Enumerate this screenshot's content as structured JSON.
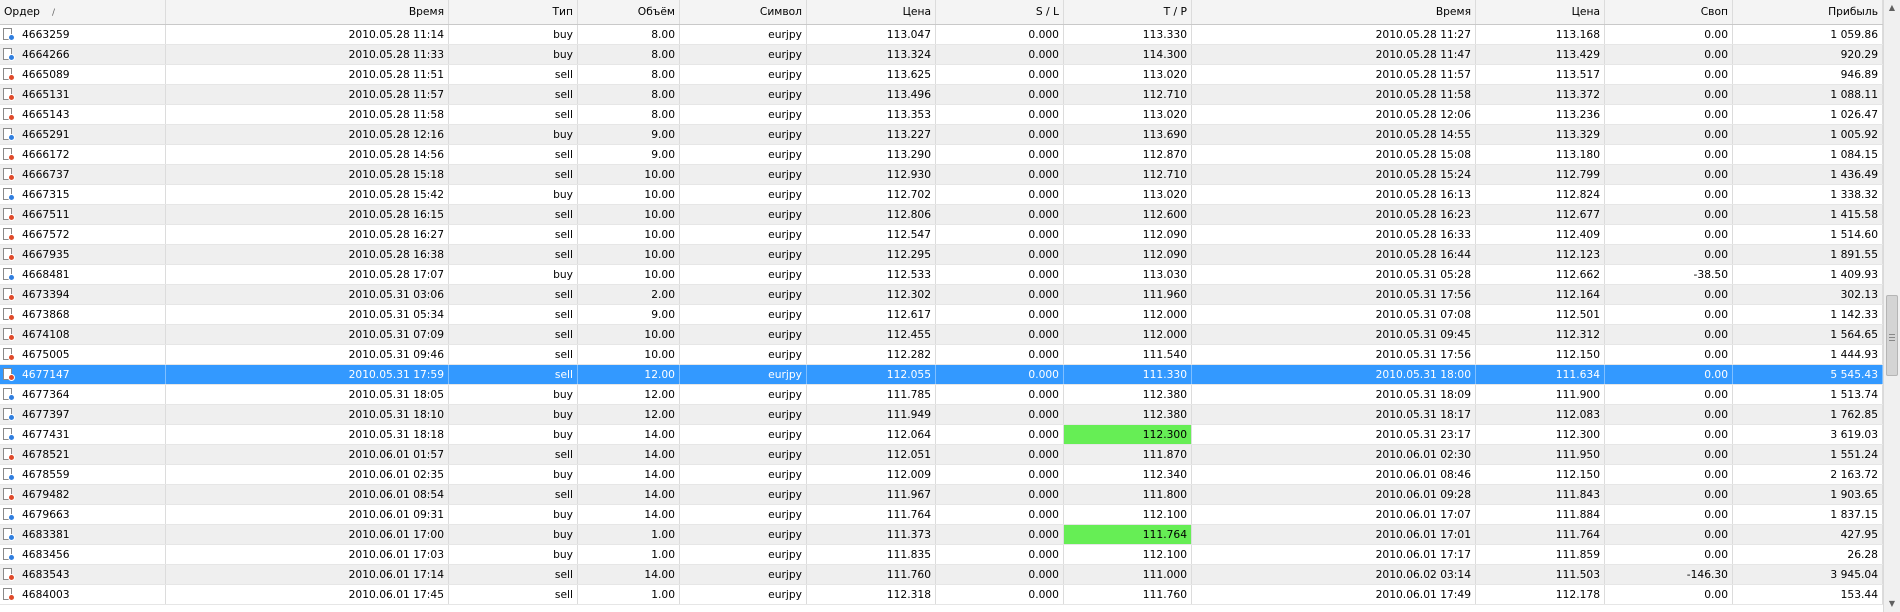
{
  "columns": [
    {
      "key": "order",
      "label": "Ордер",
      "sort_indicator": "/"
    },
    {
      "key": "open_time",
      "label": "Время"
    },
    {
      "key": "type",
      "label": "Тип"
    },
    {
      "key": "volume",
      "label": "Объём"
    },
    {
      "key": "symbol",
      "label": "Символ"
    },
    {
      "key": "open_price",
      "label": "Цена"
    },
    {
      "key": "sl",
      "label": "S / L"
    },
    {
      "key": "tp",
      "label": "T / P"
    },
    {
      "key": "close_time",
      "label": "Время"
    },
    {
      "key": "close_price",
      "label": "Цена"
    },
    {
      "key": "swap",
      "label": "Своп"
    },
    {
      "key": "profit",
      "label": "Прибыль"
    }
  ],
  "colors": {
    "selected_row": "#3399ff",
    "tp_hit": "#66ee55",
    "buy_icon": "#2f7fe0",
    "sell_icon": "#e04a2a"
  },
  "selected_order": "4677147",
  "rows": [
    {
      "order": "4663259",
      "open_time": "2010.05.28 11:14",
      "type": "buy",
      "volume": "8.00",
      "symbol": "eurjpy",
      "open_price": "113.047",
      "sl": "0.000",
      "tp": "113.330",
      "close_time": "2010.05.28 11:27",
      "close_price": "113.168",
      "swap": "0.00",
      "profit": "1 059.86"
    },
    {
      "order": "4664266",
      "open_time": "2010.05.28 11:33",
      "type": "buy",
      "volume": "8.00",
      "symbol": "eurjpy",
      "open_price": "113.324",
      "sl": "0.000",
      "tp": "114.300",
      "close_time": "2010.05.28 11:47",
      "close_price": "113.429",
      "swap": "0.00",
      "profit": "920.29"
    },
    {
      "order": "4665089",
      "open_time": "2010.05.28 11:51",
      "type": "sell",
      "volume": "8.00",
      "symbol": "eurjpy",
      "open_price": "113.625",
      "sl": "0.000",
      "tp": "113.020",
      "close_time": "2010.05.28 11:57",
      "close_price": "113.517",
      "swap": "0.00",
      "profit": "946.89"
    },
    {
      "order": "4665131",
      "open_time": "2010.05.28 11:57",
      "type": "sell",
      "volume": "8.00",
      "symbol": "eurjpy",
      "open_price": "113.496",
      "sl": "0.000",
      "tp": "112.710",
      "close_time": "2010.05.28 11:58",
      "close_price": "113.372",
      "swap": "0.00",
      "profit": "1 088.11"
    },
    {
      "order": "4665143",
      "open_time": "2010.05.28 11:58",
      "type": "sell",
      "volume": "8.00",
      "symbol": "eurjpy",
      "open_price": "113.353",
      "sl": "0.000",
      "tp": "113.020",
      "close_time": "2010.05.28 12:06",
      "close_price": "113.236",
      "swap": "0.00",
      "profit": "1 026.47"
    },
    {
      "order": "4665291",
      "open_time": "2010.05.28 12:16",
      "type": "buy",
      "volume": "9.00",
      "symbol": "eurjpy",
      "open_price": "113.227",
      "sl": "0.000",
      "tp": "113.690",
      "close_time": "2010.05.28 14:55",
      "close_price": "113.329",
      "swap": "0.00",
      "profit": "1 005.92"
    },
    {
      "order": "4666172",
      "open_time": "2010.05.28 14:56",
      "type": "sell",
      "volume": "9.00",
      "symbol": "eurjpy",
      "open_price": "113.290",
      "sl": "0.000",
      "tp": "112.870",
      "close_time": "2010.05.28 15:08",
      "close_price": "113.180",
      "swap": "0.00",
      "profit": "1 084.15"
    },
    {
      "order": "4666737",
      "open_time": "2010.05.28 15:18",
      "type": "sell",
      "volume": "10.00",
      "symbol": "eurjpy",
      "open_price": "112.930",
      "sl": "0.000",
      "tp": "112.710",
      "close_time": "2010.05.28 15:24",
      "close_price": "112.799",
      "swap": "0.00",
      "profit": "1 436.49"
    },
    {
      "order": "4667315",
      "open_time": "2010.05.28 15:42",
      "type": "buy",
      "volume": "10.00",
      "symbol": "eurjpy",
      "open_price": "112.702",
      "sl": "0.000",
      "tp": "113.020",
      "close_time": "2010.05.28 16:13",
      "close_price": "112.824",
      "swap": "0.00",
      "profit": "1 338.32"
    },
    {
      "order": "4667511",
      "open_time": "2010.05.28 16:15",
      "type": "sell",
      "volume": "10.00",
      "symbol": "eurjpy",
      "open_price": "112.806",
      "sl": "0.000",
      "tp": "112.600",
      "close_time": "2010.05.28 16:23",
      "close_price": "112.677",
      "swap": "0.00",
      "profit": "1 415.58"
    },
    {
      "order": "4667572",
      "open_time": "2010.05.28 16:27",
      "type": "sell",
      "volume": "10.00",
      "symbol": "eurjpy",
      "open_price": "112.547",
      "sl": "0.000",
      "tp": "112.090",
      "close_time": "2010.05.28 16:33",
      "close_price": "112.409",
      "swap": "0.00",
      "profit": "1 514.60"
    },
    {
      "order": "4667935",
      "open_time": "2010.05.28 16:38",
      "type": "sell",
      "volume": "10.00",
      "symbol": "eurjpy",
      "open_price": "112.295",
      "sl": "0.000",
      "tp": "112.090",
      "close_time": "2010.05.28 16:44",
      "close_price": "112.123",
      "swap": "0.00",
      "profit": "1 891.55"
    },
    {
      "order": "4668481",
      "open_time": "2010.05.28 17:07",
      "type": "buy",
      "volume": "10.00",
      "symbol": "eurjpy",
      "open_price": "112.533",
      "sl": "0.000",
      "tp": "113.030",
      "close_time": "2010.05.31 05:28",
      "close_price": "112.662",
      "swap": "-38.50",
      "profit": "1 409.93"
    },
    {
      "order": "4673394",
      "open_time": "2010.05.31 03:06",
      "type": "sell",
      "volume": "2.00",
      "symbol": "eurjpy",
      "open_price": "112.302",
      "sl": "0.000",
      "tp": "111.960",
      "close_time": "2010.05.31 17:56",
      "close_price": "112.164",
      "swap": "0.00",
      "profit": "302.13"
    },
    {
      "order": "4673868",
      "open_time": "2010.05.31 05:34",
      "type": "sell",
      "volume": "9.00",
      "symbol": "eurjpy",
      "open_price": "112.617",
      "sl": "0.000",
      "tp": "112.000",
      "close_time": "2010.05.31 07:08",
      "close_price": "112.501",
      "swap": "0.00",
      "profit": "1 142.33"
    },
    {
      "order": "4674108",
      "open_time": "2010.05.31 07:09",
      "type": "sell",
      "volume": "10.00",
      "symbol": "eurjpy",
      "open_price": "112.455",
      "sl": "0.000",
      "tp": "112.000",
      "close_time": "2010.05.31 09:45",
      "close_price": "112.312",
      "swap": "0.00",
      "profit": "1 564.65"
    },
    {
      "order": "4675005",
      "open_time": "2010.05.31 09:46",
      "type": "sell",
      "volume": "10.00",
      "symbol": "eurjpy",
      "open_price": "112.282",
      "sl": "0.000",
      "tp": "111.540",
      "close_time": "2010.05.31 17:56",
      "close_price": "112.150",
      "swap": "0.00",
      "profit": "1 444.93"
    },
    {
      "order": "4677147",
      "open_time": "2010.05.31 17:59",
      "type": "sell",
      "volume": "12.00",
      "symbol": "eurjpy",
      "open_price": "112.055",
      "sl": "0.000",
      "tp": "111.330",
      "close_time": "2010.05.31 18:00",
      "close_price": "111.634",
      "swap": "0.00",
      "profit": "5 545.43"
    },
    {
      "order": "4677364",
      "open_time": "2010.05.31 18:05",
      "type": "buy",
      "volume": "12.00",
      "symbol": "eurjpy",
      "open_price": "111.785",
      "sl": "0.000",
      "tp": "112.380",
      "close_time": "2010.05.31 18:09",
      "close_price": "111.900",
      "swap": "0.00",
      "profit": "1 513.74"
    },
    {
      "order": "4677397",
      "open_time": "2010.05.31 18:10",
      "type": "buy",
      "volume": "12.00",
      "symbol": "eurjpy",
      "open_price": "111.949",
      "sl": "0.000",
      "tp": "112.380",
      "close_time": "2010.05.31 18:17",
      "close_price": "112.083",
      "swap": "0.00",
      "profit": "1 762.85"
    },
    {
      "order": "4677431",
      "open_time": "2010.05.31 18:18",
      "type": "buy",
      "volume": "14.00",
      "symbol": "eurjpy",
      "open_price": "112.064",
      "sl": "0.000",
      "tp": "112.300",
      "tp_hit": true,
      "close_time": "2010.05.31 23:17",
      "close_price": "112.300",
      "swap": "0.00",
      "profit": "3 619.03"
    },
    {
      "order": "4678521",
      "open_time": "2010.06.01 01:57",
      "type": "sell",
      "volume": "14.00",
      "symbol": "eurjpy",
      "open_price": "112.051",
      "sl": "0.000",
      "tp": "111.870",
      "close_time": "2010.06.01 02:30",
      "close_price": "111.950",
      "swap": "0.00",
      "profit": "1 551.24"
    },
    {
      "order": "4678559",
      "open_time": "2010.06.01 02:35",
      "type": "buy",
      "volume": "14.00",
      "symbol": "eurjpy",
      "open_price": "112.009",
      "sl": "0.000",
      "tp": "112.340",
      "close_time": "2010.06.01 08:46",
      "close_price": "112.150",
      "swap": "0.00",
      "profit": "2 163.72"
    },
    {
      "order": "4679482",
      "open_time": "2010.06.01 08:54",
      "type": "sell",
      "volume": "14.00",
      "symbol": "eurjpy",
      "open_price": "111.967",
      "sl": "0.000",
      "tp": "111.800",
      "close_time": "2010.06.01 09:28",
      "close_price": "111.843",
      "swap": "0.00",
      "profit": "1 903.65"
    },
    {
      "order": "4679663",
      "open_time": "2010.06.01 09:31",
      "type": "buy",
      "volume": "14.00",
      "symbol": "eurjpy",
      "open_price": "111.764",
      "sl": "0.000",
      "tp": "112.100",
      "close_time": "2010.06.01 17:07",
      "close_price": "111.884",
      "swap": "0.00",
      "profit": "1 837.15"
    },
    {
      "order": "4683381",
      "open_time": "2010.06.01 17:00",
      "type": "buy",
      "volume": "1.00",
      "symbol": "eurjpy",
      "open_price": "111.373",
      "sl": "0.000",
      "tp": "111.764",
      "tp_hit": true,
      "close_time": "2010.06.01 17:01",
      "close_price": "111.764",
      "swap": "0.00",
      "profit": "427.95"
    },
    {
      "order": "4683456",
      "open_time": "2010.06.01 17:03",
      "type": "buy",
      "volume": "1.00",
      "symbol": "eurjpy",
      "open_price": "111.835",
      "sl": "0.000",
      "tp": "112.100",
      "close_time": "2010.06.01 17:17",
      "close_price": "111.859",
      "swap": "0.00",
      "profit": "26.28"
    },
    {
      "order": "4683543",
      "open_time": "2010.06.01 17:14",
      "type": "sell",
      "volume": "14.00",
      "symbol": "eurjpy",
      "open_price": "111.760",
      "sl": "0.000",
      "tp": "111.000",
      "close_time": "2010.06.02 03:14",
      "close_price": "111.503",
      "swap": "-146.30",
      "profit": "3 945.04"
    },
    {
      "order": "4684003",
      "open_time": "2010.06.01 17:45",
      "type": "sell",
      "volume": "1.00",
      "symbol": "eurjpy",
      "open_price": "112.318",
      "sl": "0.000",
      "tp": "111.760",
      "close_time": "2010.06.01 17:49",
      "close_price": "112.178",
      "swap": "0.00",
      "profit": "153.44"
    }
  ],
  "scrollbar": {
    "position_fraction": 0.56,
    "thumb_fraction": 0.14
  }
}
